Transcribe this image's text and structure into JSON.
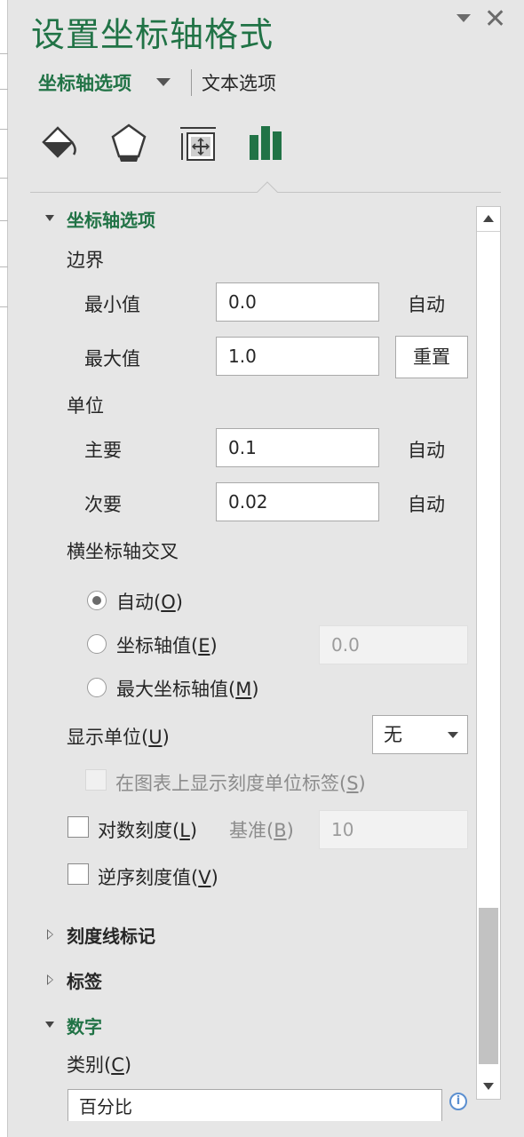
{
  "pane": {
    "title": "设置坐标轴格式",
    "option_tabs": {
      "active": "坐标轴选项",
      "other": "文本选项"
    },
    "icon_tabs": [
      "fill-line-icon",
      "effects-icon",
      "size-properties-icon",
      "axis-options-icon"
    ]
  },
  "axis_options": {
    "header": "坐标轴选项",
    "bounds": {
      "label": "边界",
      "min": {
        "label": "最小值",
        "value": "0.0",
        "action": "自动"
      },
      "max": {
        "label": "最大值",
        "value": "1.0",
        "action": "重置"
      }
    },
    "units": {
      "label": "单位",
      "major": {
        "label": "主要",
        "value": "0.1",
        "action": "自动"
      },
      "minor": {
        "label": "次要",
        "value": "0.02",
        "action": "自动"
      }
    },
    "crosses": {
      "label": "横坐标轴交叉",
      "options": [
        {
          "text": "自动(",
          "key": "O",
          "tail": ")",
          "checked": true
        },
        {
          "text": "坐标轴值(",
          "key": "E",
          "tail": ")",
          "checked": false
        },
        {
          "text": "最大坐标轴值(",
          "key": "M",
          "tail": ")",
          "checked": false
        }
      ],
      "axis_value": "0.0"
    },
    "display_units": {
      "label_text": "显示单位(",
      "key": "U",
      "tail": ")",
      "value": "无"
    },
    "show_units_label": {
      "text": "在图表上显示刻度单位标签(",
      "key": "S",
      "tail": ")",
      "checked": false
    },
    "log_scale": {
      "text": "对数刻度(",
      "key": "L",
      "tail": ")",
      "checked": false,
      "base_text": "基准(",
      "base_key": "B",
      "base_tail": ")",
      "base_value": "10"
    },
    "reverse": {
      "text": "逆序刻度值(",
      "key": "V",
      "tail": ")",
      "checked": false
    }
  },
  "sections": {
    "tick_marks": "刻度线标记",
    "labels": "标签",
    "number": "数字"
  },
  "number": {
    "category_text": "类别(",
    "category_key": "C",
    "category_tail": ")",
    "category_value": "百分比"
  },
  "colors": {
    "accent": "#217346",
    "pane_bg": "#e6e6e6"
  }
}
